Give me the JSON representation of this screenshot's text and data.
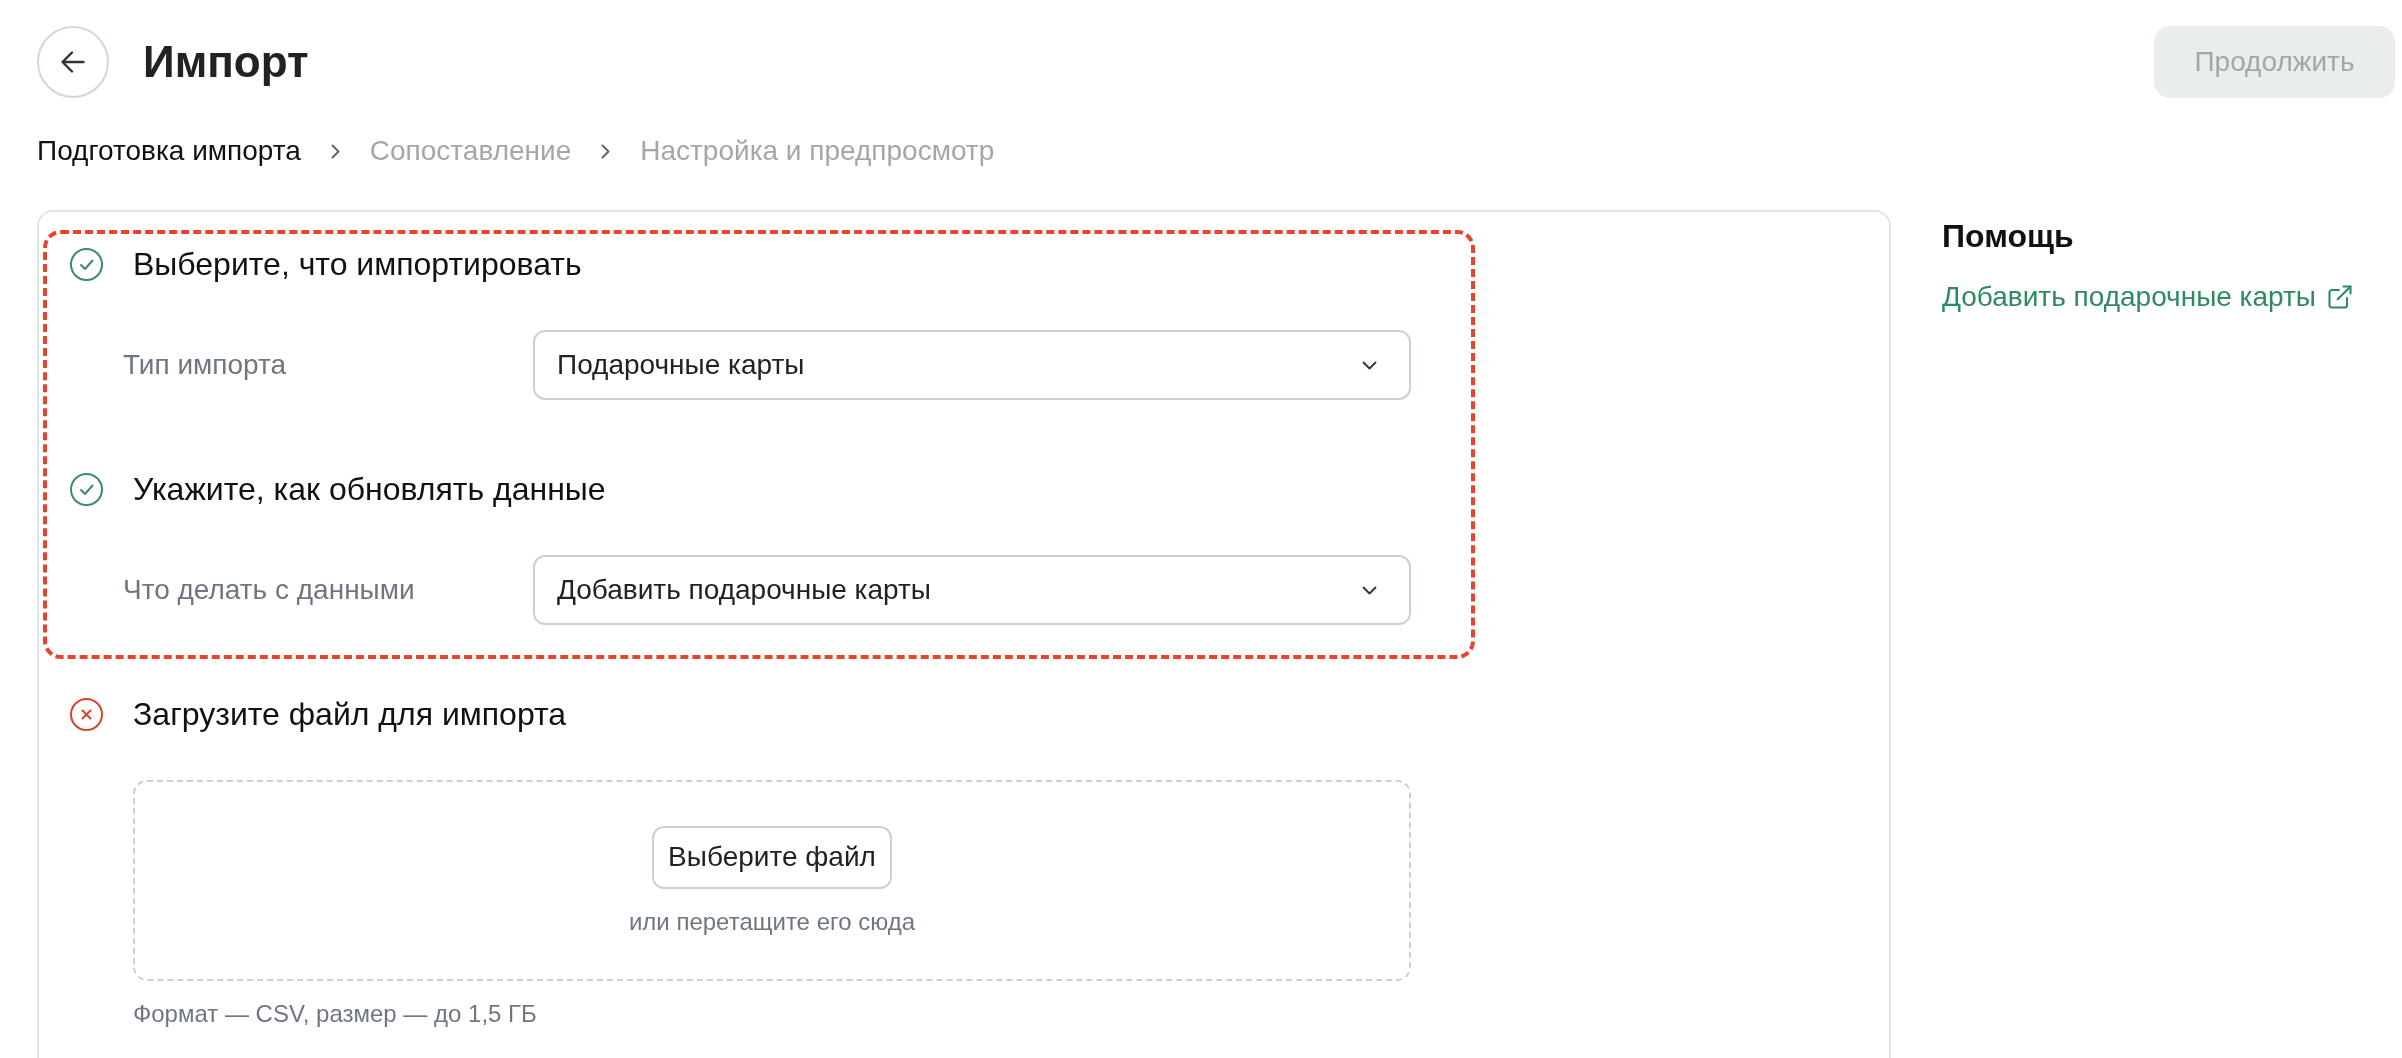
{
  "header": {
    "title": "Импорт",
    "continue_button": {
      "label": "Продолжить",
      "disabled": true
    }
  },
  "breadcrumb": [
    {
      "label": "Подготовка импорта",
      "selected": true
    },
    {
      "label": "Сопоставление",
      "selected": false
    },
    {
      "label": "Настройка и предпросмотр",
      "selected": false
    }
  ],
  "sections": [
    {
      "kind": "select",
      "title": "Выберите, что импортировать",
      "complete": true,
      "highlighted": true,
      "field": {
        "label": "Тип импорта",
        "value": "Подарочные карты"
      }
    },
    {
      "kind": "select",
      "title": "Укажите, как обновлять данные",
      "complete": true,
      "highlighted": true,
      "field": {
        "label": "Что делать с данными",
        "value": "Добавить подарочные карты"
      }
    },
    {
      "kind": "upload",
      "title": "Загрузите файл для импорта",
      "complete": false,
      "highlighted": false,
      "upload": {
        "button": "Выберите файл",
        "hint": "или перетащите его сюда",
        "note": "Формат — CSV, размер — до 1,5 ГБ"
      }
    }
  ],
  "help": {
    "title": "Помощь",
    "links": [
      {
        "label": "Добавить подарочные карты"
      }
    ]
  }
}
